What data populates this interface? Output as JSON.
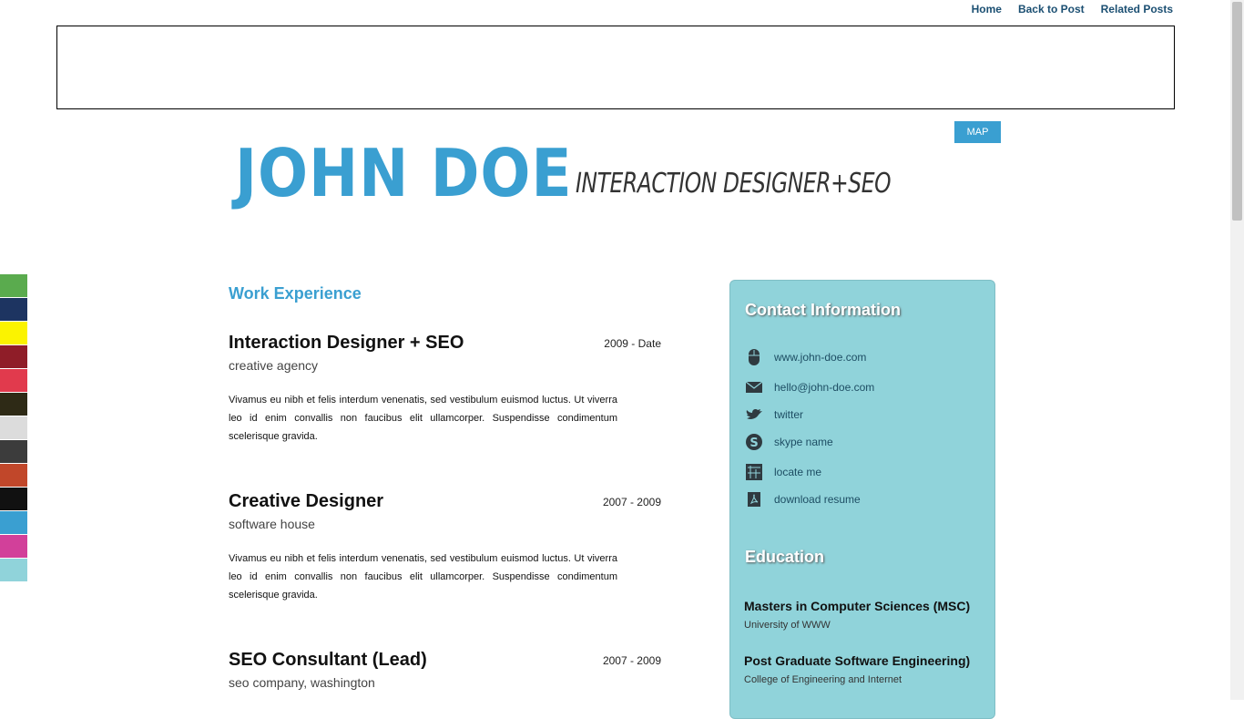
{
  "topnav": {
    "home": "Home",
    "back": "Back to Post",
    "related": "Related Posts"
  },
  "map_button": "MAP",
  "header": {
    "name": "JOHN DOE",
    "tagline": "INTERACTION DESIGNER+SEO"
  },
  "swatches": [
    "#5aab4e",
    "#1d3461",
    "#fbf300",
    "#8f1d28",
    "#e13a4d",
    "#2e2a16",
    "#dcdcdc",
    "#3c3c3c",
    "#c1472a",
    "#111111",
    "#3a9fd1",
    "#d2409a",
    "#90d3da"
  ],
  "work": {
    "title": "Work Experience",
    "jobs": [
      {
        "title": "Interaction Designer + SEO",
        "date": "2009 - Date",
        "company": "creative agency",
        "desc": "Vivamus eu nibh et felis interdum venenatis, sed vestibulum euismod luctus. Ut viverra leo id enim convallis non faucibus elit ullamcorper. Suspendisse condimentum scelerisque gravida."
      },
      {
        "title": "Creative Designer",
        "date": "2007 - 2009",
        "company": "software house",
        "desc": "Vivamus eu nibh et felis interdum venenatis, sed vestibulum euismod luctus. Ut viverra leo id enim convallis non faucibus elit ullamcorper. Suspendisse condimentum scelerisque gravida."
      },
      {
        "title": "SEO Consultant (Lead)",
        "date": "2007 - 2009",
        "company": "seo company, washington"
      }
    ]
  },
  "contact": {
    "title": "Contact Information",
    "items": [
      {
        "icon": "mouse-icon",
        "label": "www.john-doe.com"
      },
      {
        "icon": "envelope-icon",
        "label": "hello@john-doe.com"
      },
      {
        "icon": "twitter-bird-icon",
        "label": "twitter"
      },
      {
        "icon": "skype-icon",
        "label": "skype name"
      },
      {
        "icon": "map-icon",
        "label": "locate me"
      },
      {
        "icon": "pdf-icon",
        "label": "download resume"
      }
    ]
  },
  "education": {
    "title": "Education",
    "items": [
      {
        "degree": "Masters in Computer Sciences (MSC)",
        "school": "University of WWW"
      },
      {
        "degree": "Post Graduate Software Engineering)",
        "school": "College of Engineering and Internet"
      }
    ]
  }
}
